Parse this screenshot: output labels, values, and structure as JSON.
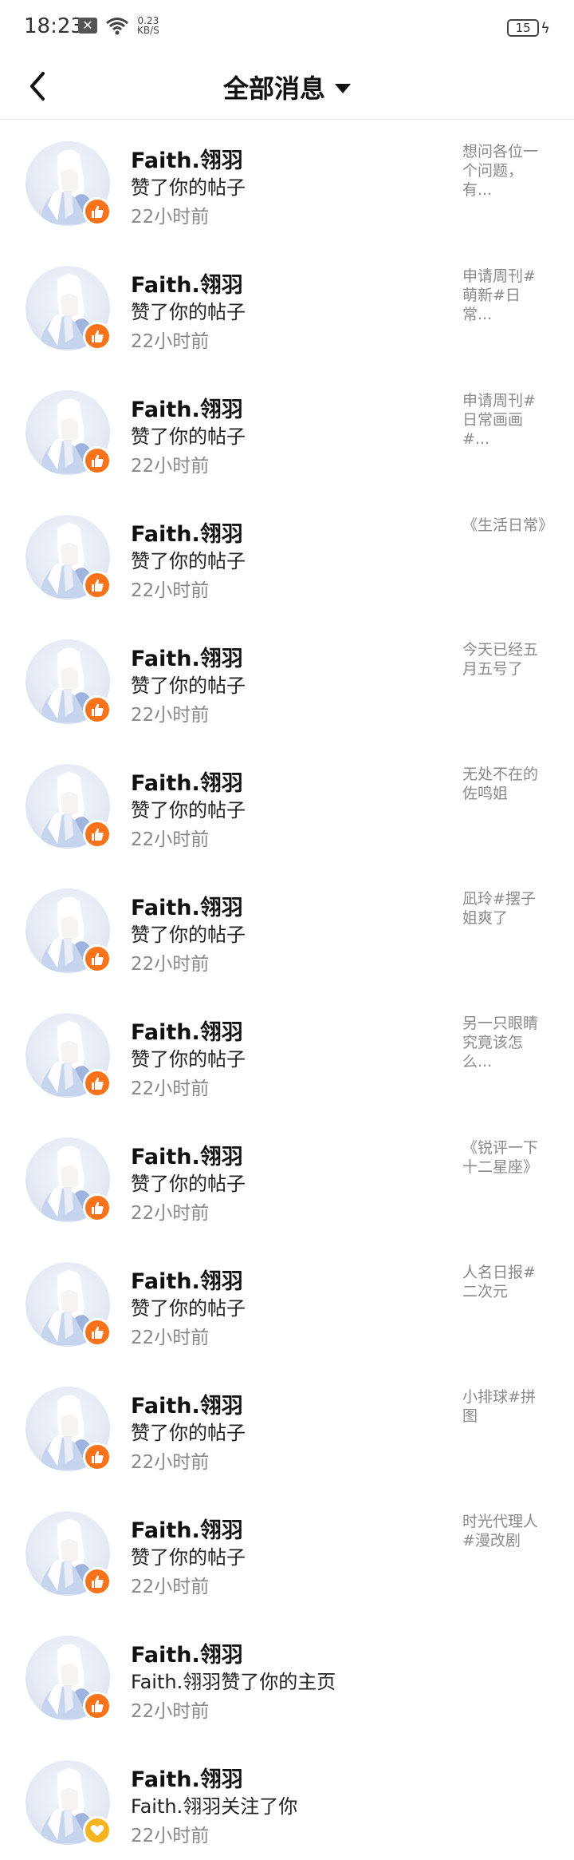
{
  "status_bar": {
    "time": "18:23",
    "net_speed_value": "0.23",
    "net_speed_unit": "KB/S",
    "battery": "15"
  },
  "header": {
    "title": "全部消息"
  },
  "items": [
    {
      "name": "Faith.翎羽",
      "action": "赞了你的帖子",
      "time": "22小时前",
      "snippet": "想问各位一个问题，有...",
      "badge": "like"
    },
    {
      "name": "Faith.翎羽",
      "action": "赞了你的帖子",
      "time": "22小时前",
      "snippet": "申请周刊#萌新#日常...",
      "badge": "like"
    },
    {
      "name": "Faith.翎羽",
      "action": "赞了你的帖子",
      "time": "22小时前",
      "snippet": "申请周刊#日常画画#...",
      "badge": "like"
    },
    {
      "name": "Faith.翎羽",
      "action": "赞了你的帖子",
      "time": "22小时前",
      "snippet": "《生活日常》",
      "badge": "like"
    },
    {
      "name": "Faith.翎羽",
      "action": "赞了你的帖子",
      "time": "22小时前",
      "snippet": "今天已经五月五号了",
      "badge": "like"
    },
    {
      "name": "Faith.翎羽",
      "action": "赞了你的帖子",
      "time": "22小时前",
      "snippet": "无处不在的佐鸣姐",
      "badge": "like"
    },
    {
      "name": "Faith.翎羽",
      "action": "赞了你的帖子",
      "time": "22小时前",
      "snippet": "凪玲#摆子姐爽了",
      "badge": "like"
    },
    {
      "name": "Faith.翎羽",
      "action": "赞了你的帖子",
      "time": "22小时前",
      "snippet": "另一只眼睛究竟该怎么...",
      "badge": "like"
    },
    {
      "name": "Faith.翎羽",
      "action": "赞了你的帖子",
      "time": "22小时前",
      "snippet": "《锐评一下十二星座》",
      "badge": "like"
    },
    {
      "name": "Faith.翎羽",
      "action": "赞了你的帖子",
      "time": "22小时前",
      "snippet": "人名日报#二次元",
      "badge": "like"
    },
    {
      "name": "Faith.翎羽",
      "action": "赞了你的帖子",
      "time": "22小时前",
      "snippet": "小排球#拼图",
      "badge": "like"
    },
    {
      "name": "Faith.翎羽",
      "action": "赞了你的帖子",
      "time": "22小时前",
      "snippet": "时光代理人#漫改剧",
      "badge": "like"
    },
    {
      "name": "Faith.翎羽",
      "action": "Faith.翎羽赞了你的主页",
      "time": "22小时前",
      "snippet": "",
      "badge": "like"
    },
    {
      "name": "Faith.翎羽",
      "action": "Faith.翎羽关注了你",
      "time": "22小时前",
      "snippet": "",
      "badge": "heart"
    }
  ],
  "icons": {
    "back": "chevron-left-icon",
    "dropdown": "caret-down-icon",
    "like_badge": "thumbs-up-icon",
    "follow_badge": "heart-icon"
  },
  "colors": {
    "like_badge": "#f7741d",
    "follow_badge": "#f6b51e",
    "secondary_text": "#888888"
  }
}
